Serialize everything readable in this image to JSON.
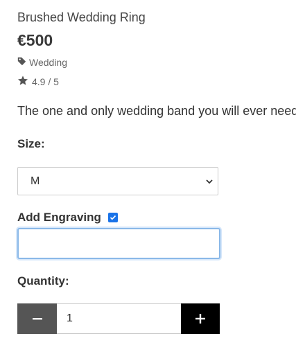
{
  "product": {
    "title": "Brushed Wedding Ring",
    "price": "€500",
    "tag": "Wedding",
    "rating": "4.9 / 5",
    "description": "The one and only wedding band you will ever need"
  },
  "size": {
    "label": "Size:",
    "selected": "M"
  },
  "engraving": {
    "label": "Add Engraving",
    "checked": true,
    "value": ""
  },
  "quantity": {
    "label": "Quantity:",
    "value": "1"
  },
  "icons": {
    "tag": "tag-icon",
    "star": "star-icon",
    "chevron": "chevron-down-icon",
    "minus": "minus-icon",
    "plus": "plus-icon",
    "check": "check-icon"
  },
  "colors": {
    "checkbox": "#1a73e8",
    "minus_button": "#555555",
    "plus_button": "#000000",
    "input_focus": "#8ab8e8"
  }
}
